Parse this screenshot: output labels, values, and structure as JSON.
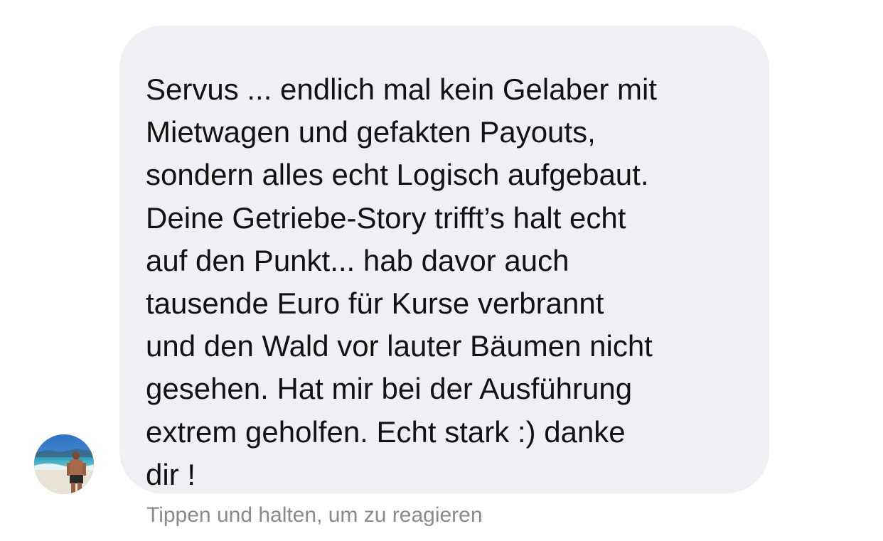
{
  "message": {
    "lines": [
      "Servus ... endlich mal kein Gelaber mit",
      "Mietwagen und gefakten Payouts,",
      "sondern alles echt Logisch aufgebaut.",
      "Deine Getriebe-Story trifft’s halt echt",
      "auf den Punkt... hab davor auch",
      "tausende Euro für Kurse verbrannt",
      "und den Wald vor lauter Bäumen nicht",
      "gesehen. Hat mir bei der Ausführung",
      "extrem geholfen. Echt stark :) danke",
      "dir !"
    ]
  },
  "hint": {
    "text": "Tippen und halten, um zu reagieren"
  },
  "colors": {
    "bubble_background": "#efeff4",
    "text": "#121212",
    "hint": "#8a8a8e"
  }
}
